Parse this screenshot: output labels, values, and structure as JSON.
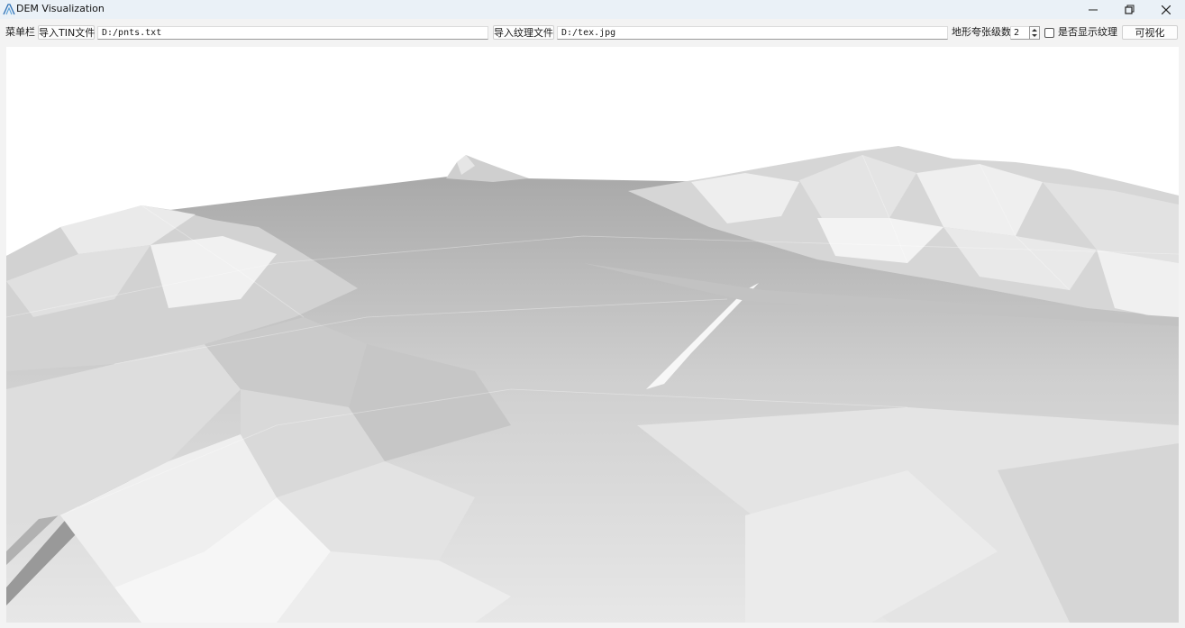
{
  "window": {
    "title": "DEM Visualization",
    "minimize_label": "minimize",
    "restore_label": "restore",
    "close_label": "close"
  },
  "toolbar": {
    "menu_label": "菜单栏",
    "import_tin_button": "导入TIN文件",
    "tin_path": "D:/pnts.txt",
    "import_texture_button": "导入纹理文件",
    "texture_path": "D:/tex.jpg",
    "exaggeration_label": "地形夸张级数",
    "exaggeration_value": "2",
    "show_texture_label": "是否显示纹理",
    "show_texture_checked": false,
    "visualize_button": "可视化"
  },
  "viewport": {
    "content": "3D TIN terrain render",
    "background_color": "#ffffff",
    "surface_palette": [
      "#eeeeee",
      "#d8d8d8",
      "#bdbdbd",
      "#a7a7a7",
      "#8f8f8f"
    ]
  },
  "icons": {
    "app": "app-logo-icon",
    "minimize": "minimize-icon",
    "restore": "restore-icon",
    "close": "close-icon",
    "spin": "spin-arrows-icon"
  }
}
